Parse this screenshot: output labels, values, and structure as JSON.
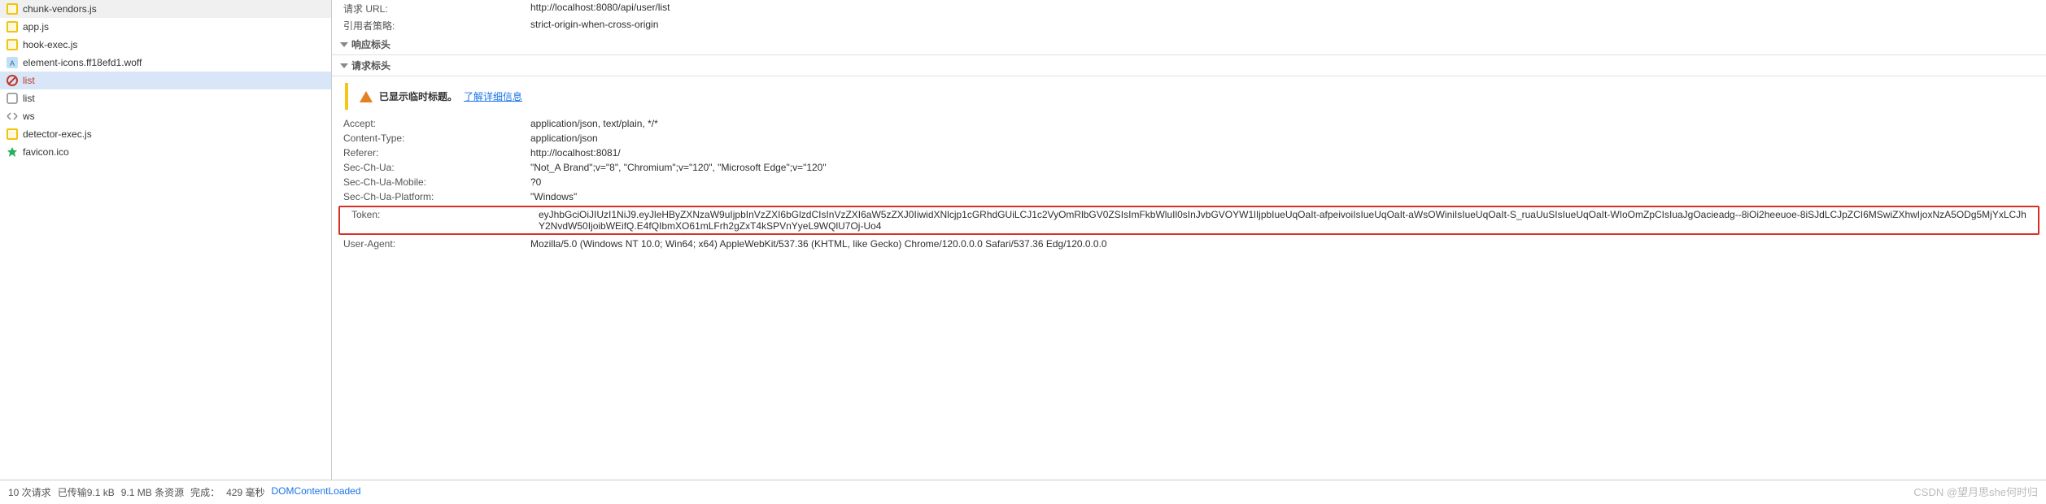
{
  "sidebar": {
    "items": [
      {
        "name": "chunk-vendors.js",
        "icon": "js-yellow",
        "selected": false,
        "red": false,
        "data_name": "file-chunk-vendors-js"
      },
      {
        "name": "app.js",
        "icon": "js-yellow",
        "selected": false,
        "red": false,
        "data_name": "file-app-js"
      },
      {
        "name": "hook-exec.js",
        "icon": "js-yellow",
        "selected": false,
        "red": false,
        "data_name": "file-hook-exec-js"
      },
      {
        "name": "element-icons.ff18efd1.woff",
        "icon": "font-blue",
        "selected": false,
        "red": false,
        "data_name": "file-element-icons-woff"
      },
      {
        "name": "list",
        "icon": "blocked-red",
        "selected": true,
        "red": true,
        "data_name": "file-list-blocked"
      },
      {
        "name": "list",
        "icon": "square-gray",
        "selected": false,
        "red": false,
        "data_name": "file-list"
      },
      {
        "name": "ws",
        "icon": "ws",
        "selected": false,
        "red": false,
        "data_name": "file-ws"
      },
      {
        "name": "detector-exec.js",
        "icon": "js-yellow",
        "selected": false,
        "red": false,
        "data_name": "file-detector-exec-js"
      },
      {
        "name": "favicon.ico",
        "icon": "favicon",
        "selected": false,
        "red": false,
        "data_name": "file-favicon-ico"
      }
    ]
  },
  "general": {
    "rows": [
      {
        "key": "请求 URL:",
        "val": "http://localhost:8080/api/user/list"
      },
      {
        "key": "引用者策略:",
        "val": "strict-origin-when-cross-origin"
      }
    ]
  },
  "response_header_title": "响应标头",
  "request_header_title": "请求标头",
  "notice": {
    "strong": "已显示临时标题。",
    "link": "了解详细信息"
  },
  "request_headers": {
    "pre": [
      {
        "key": "Accept:",
        "val": "application/json, text/plain, */*"
      },
      {
        "key": "Content-Type:",
        "val": "application/json"
      },
      {
        "key": "Referer:",
        "val": "http://localhost:8081/"
      },
      {
        "key": "Sec-Ch-Ua:",
        "val": "\"Not_A Brand\";v=\"8\", \"Chromium\";v=\"120\", \"Microsoft Edge\";v=\"120\""
      },
      {
        "key": "Sec-Ch-Ua-Mobile:",
        "val": "?0"
      },
      {
        "key": "Sec-Ch-Ua-Platform:",
        "val": "\"Windows\""
      }
    ],
    "token": {
      "key": "Token:",
      "val": "eyJhbGciOiJIUzI1NiJ9.eyJleHByZXNzaW9uIjpbInVzZXI6bGlzdCIsInVzZXI6aW5zZXJ0IiwidXNlcjp1cGRhdGUiLCJ1c2VyOmRlbGV0ZSIsImFkbWluIl0sInJvbGVOYW1lIjpbIueUqOaIt-afpeivoiIsIueUqOaIt-aWsOWiniIsIueUqOaIt-S_ruaUuSIsIueUqOaIt-WIoOmZpCIsIuaJgOacieadg--8iOi2heeuoe-8iSJdLCJpZCI6MSwiZXhwIjoxNzA5ODg5MjYxLCJhY2NvdW50IjoibWEifQ.E4fQIbmXO61mLFrh2gZxT4kSPVnYyeL9WQlU7Oj-Uo4"
    },
    "post": [
      {
        "key": "User-Agent:",
        "val": "Mozilla/5.0 (Windows NT 10.0; Win64; x64) AppleWebKit/537.36 (KHTML, like Gecko) Chrome/120.0.0.0 Safari/537.36 Edg/120.0.0.0"
      }
    ]
  },
  "footer": {
    "requests": "10 次请求",
    "transferred": "已传输9.1 kB",
    "resources": "9.1 MB 条资源",
    "finish_label": "完成：",
    "finish_val": "429 毫秒",
    "dom": "DOMContentLoaded"
  },
  "watermark": "CSDN @望月思she何时归"
}
